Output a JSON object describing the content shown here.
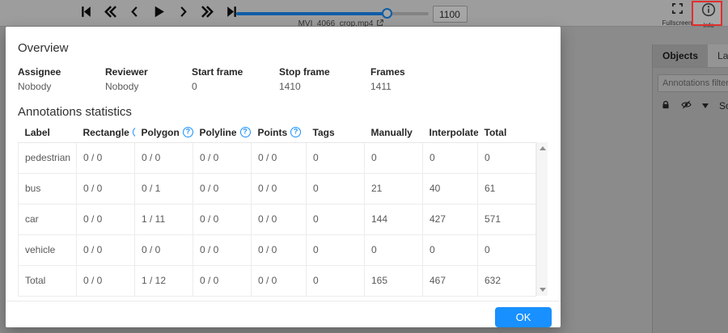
{
  "toolbar": {
    "filename": "MVI_4066_crop.mp4",
    "frame_value": "1100",
    "slider_percent": 78
  },
  "header_right": {
    "fullscreen_label": "Fullscreen",
    "info_label": "Info"
  },
  "sidebar": {
    "tabs": [
      {
        "label": "Objects",
        "active": true
      },
      {
        "label": "Labels",
        "active": false
      }
    ],
    "filter_placeholder": "Annotations filter",
    "sort_label": "Sort"
  },
  "modal": {
    "overview_title": "Overview",
    "fields": [
      {
        "label": "Assignee",
        "value": "Nobody"
      },
      {
        "label": "Reviewer",
        "value": "Nobody"
      },
      {
        "label": "Start frame",
        "value": "0"
      },
      {
        "label": "Stop frame",
        "value": "1410"
      },
      {
        "label": "Frames",
        "value": "1411"
      }
    ],
    "stats_title": "Annotations statistics",
    "table": {
      "columns": [
        {
          "label": "Label",
          "help": false
        },
        {
          "label": "Rectangle",
          "help": true
        },
        {
          "label": "Polygon",
          "help": true
        },
        {
          "label": "Polyline",
          "help": true
        },
        {
          "label": "Points",
          "help": true
        },
        {
          "label": "Tags",
          "help": false
        },
        {
          "label": "Manually",
          "help": false
        },
        {
          "label": "Interpolated",
          "help": false
        },
        {
          "label": "Total",
          "help": false
        }
      ],
      "rows": [
        [
          "pedestrian",
          "0 / 0",
          "0 / 0",
          "0 / 0",
          "0 / 0",
          "0",
          "0",
          "0",
          "0"
        ],
        [
          "bus",
          "0 / 0",
          "0 / 1",
          "0 / 0",
          "0 / 0",
          "0",
          "21",
          "40",
          "61"
        ],
        [
          "car",
          "0 / 0",
          "1 / 11",
          "0 / 0",
          "0 / 0",
          "0",
          "144",
          "427",
          "571"
        ],
        [
          "vehicle",
          "0 / 0",
          "0 / 0",
          "0 / 0",
          "0 / 0",
          "0",
          "0",
          "0",
          "0"
        ],
        [
          "Total",
          "0 / 0",
          "1 / 12",
          "0 / 0",
          "0 / 0",
          "0",
          "165",
          "467",
          "632"
        ]
      ]
    },
    "ok_label": "OK"
  },
  "colors": {
    "accent": "#1890ff",
    "highlight_red": "#e12f2f"
  }
}
